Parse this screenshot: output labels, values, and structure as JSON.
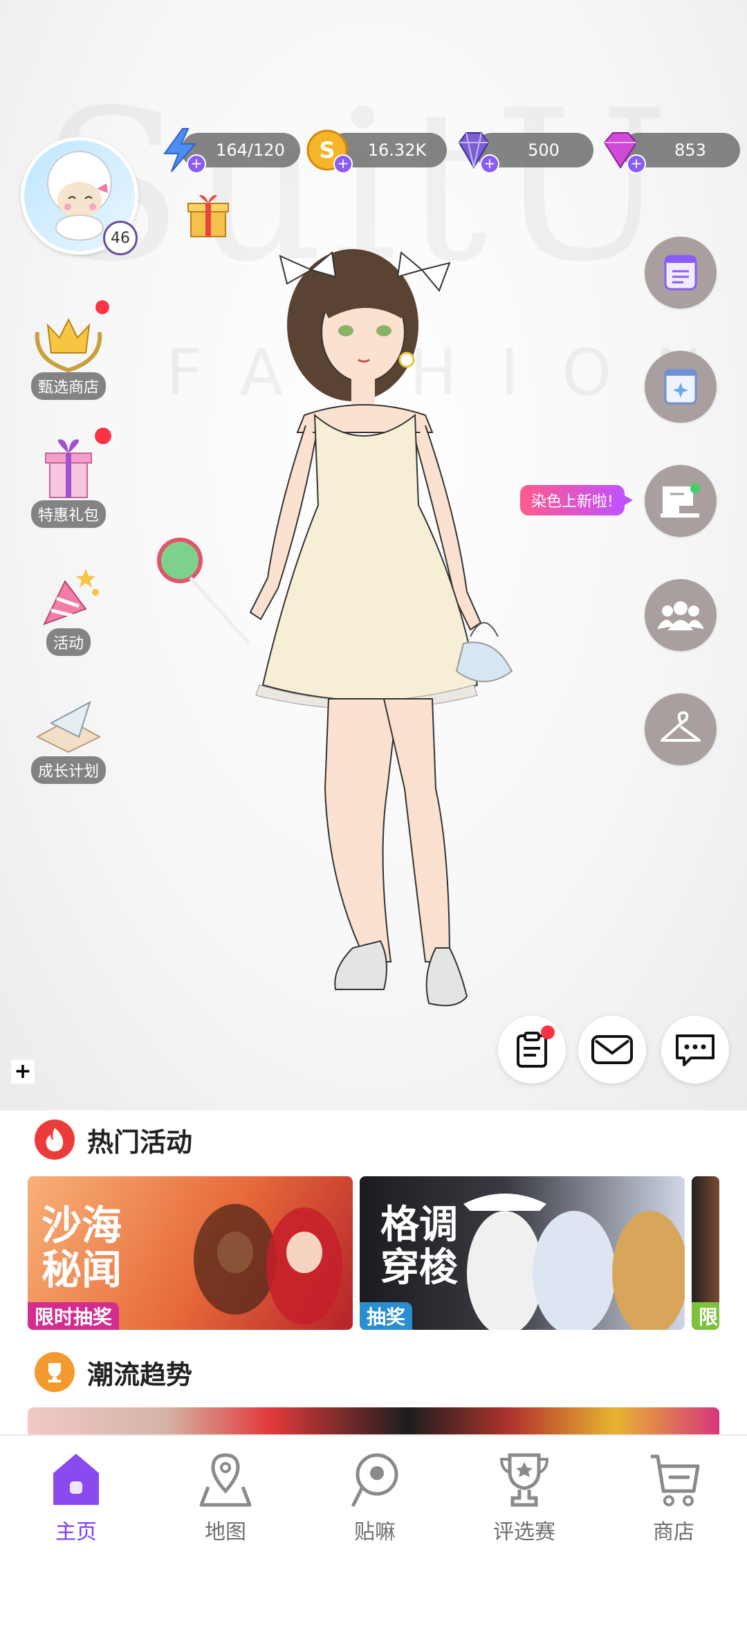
{
  "watermark": {
    "brand": "SuitU",
    "sub": "FASHION™"
  },
  "profile": {
    "level": "46"
  },
  "currencies": [
    {
      "name": "stamina",
      "icon": "lightning-icon",
      "value": "164/120"
    },
    {
      "name": "coins",
      "icon": "coin-icon",
      "value": "16.32K"
    },
    {
      "name": "diamonds",
      "icon": "diamond-icon",
      "value": "500"
    },
    {
      "name": "gems",
      "icon": "gem-icon",
      "value": "853"
    }
  ],
  "left_menu": [
    {
      "label": "甄选商店",
      "icon": "crown-icon",
      "badge": true
    },
    {
      "label": "特惠礼包",
      "icon": "gift-box-icon",
      "badge": true
    },
    {
      "label": "活动",
      "icon": "party-popper-icon",
      "badge": false
    },
    {
      "label": "成长计划",
      "icon": "paper-plane-icon",
      "badge": false
    }
  ],
  "right_menu": [
    {
      "name": "tasks",
      "icon": "list-icon"
    },
    {
      "name": "guide",
      "icon": "book-icon"
    },
    {
      "name": "dye",
      "icon": "sewing-machine-icon"
    },
    {
      "name": "friends",
      "icon": "group-icon"
    },
    {
      "name": "wardrobe",
      "icon": "hanger-icon"
    }
  ],
  "dye_bubble": "染色上新啦!",
  "hot_section": {
    "title": "热门活动",
    "cards": [
      {
        "title": "沙海秘闻",
        "tag": "限时抽奖",
        "tag_color": "#d42d8e"
      },
      {
        "title": "格调穿梭",
        "tag": "抽奖",
        "tag_color": "#2a8fd0"
      },
      {
        "title": "",
        "tag": "限",
        "tag_color": "#7cc23a"
      }
    ]
  },
  "trend_section": {
    "title": "潮流趋势"
  },
  "nav": [
    {
      "label": "主页",
      "icon": "home-icon",
      "active": true
    },
    {
      "label": "地图",
      "icon": "map-pin-icon",
      "active": false
    },
    {
      "label": "贴嘛",
      "icon": "chat-circle-icon",
      "active": false
    },
    {
      "label": "评选赛",
      "icon": "trophy-icon",
      "active": false
    },
    {
      "label": "商店",
      "icon": "cart-icon",
      "active": false
    }
  ],
  "colors": {
    "accent": "#7f3df2",
    "badge": "#ff3345"
  }
}
